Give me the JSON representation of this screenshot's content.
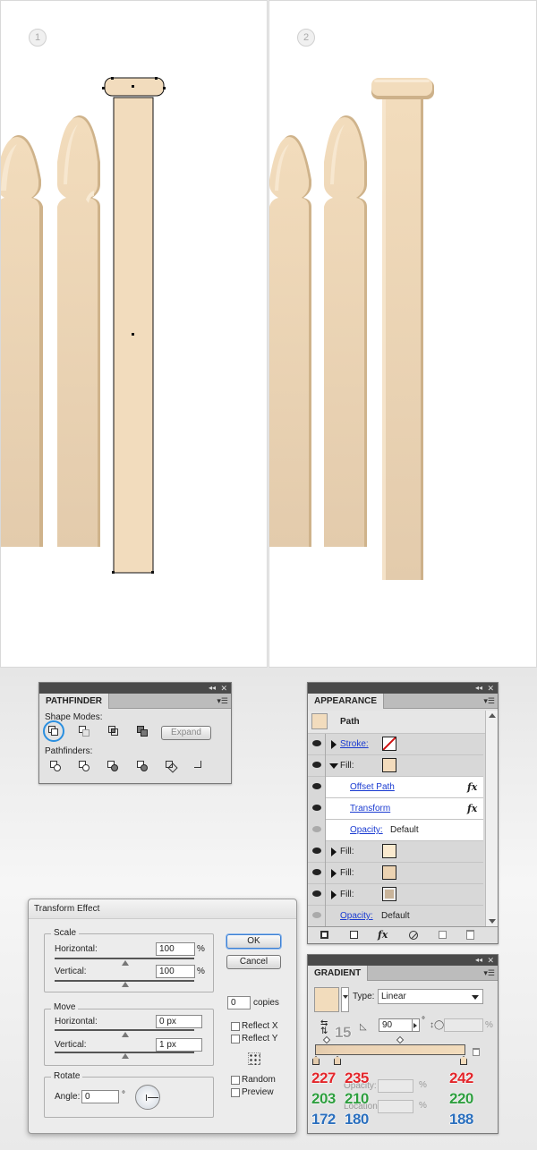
{
  "steps": [
    "1",
    "2"
  ],
  "colors": {
    "picket_light": "#f3dcbd",
    "picket_mid": "#ecd3b2",
    "picket_dark": "#cfb38b",
    "stop1": "#e3cbac",
    "stop2": "#ebd2b4",
    "stop3": "#f2dcbc"
  },
  "pathfinder": {
    "tab": "PATHFINDER",
    "shape_modes_label": "Shape Modes:",
    "expand_label": "Expand",
    "pathfinders_label": "Pathfinders:",
    "shape_mode_icons": [
      "unite-icon",
      "minus-front-icon",
      "intersect-icon",
      "exclude-icon"
    ],
    "pathfinder_icons": [
      "divide-icon",
      "trim-icon",
      "merge-icon",
      "crop-icon",
      "outline-icon",
      "minus-back-icon"
    ]
  },
  "appearance": {
    "tab": "APPEARANCE",
    "object": "Path",
    "rows": [
      {
        "label": "Stroke:",
        "type": "stroke",
        "link": true
      },
      {
        "label": "Fill:",
        "type": "fill-open",
        "swatch": "#f3dcbd"
      },
      {
        "label": "Offset Path",
        "type": "effect",
        "link": true
      },
      {
        "label": "Transform",
        "type": "effect",
        "link": true
      },
      {
        "label": "Opacity:",
        "value": "Default",
        "type": "opacity",
        "link": true
      },
      {
        "label": "Fill:",
        "type": "fill",
        "swatch": "#faeacf"
      },
      {
        "label": "Fill:",
        "type": "fill",
        "swatch": "#ecd3b2"
      },
      {
        "label": "Fill:",
        "type": "fill",
        "swatch": "#c9b49a"
      },
      {
        "label": "Opacity:",
        "value": "Default",
        "type": "opacity",
        "link": true
      }
    ],
    "fx_symbol": "fx"
  },
  "transform_effect": {
    "title": "Transform Effect",
    "scale_label": "Scale",
    "horizontal_label": "Horizontal:",
    "vertical_label": "Vertical:",
    "scale_h": "100",
    "scale_v": "100",
    "percent": "%",
    "move_label": "Move",
    "move_h": "0 px",
    "move_v": "1 px",
    "rotate_label": "Rotate",
    "angle_label": "Angle:",
    "angle": "0",
    "degree": "°",
    "ok": "OK",
    "cancel": "Cancel",
    "copies_value": "0",
    "copies_label": "copies",
    "reflect_x": "Reflect X",
    "reflect_y": "Reflect Y",
    "random": "Random",
    "preview": "Preview"
  },
  "gradient": {
    "tab": "GRADIENT",
    "type_label": "Type:",
    "type_value": "Linear",
    "angle_value": "90",
    "degree": "°",
    "percent": "%",
    "opacity_label": "Opacity:",
    "location_label": "Location:",
    "annotation_angle": "15",
    "rgb_columns": [
      {
        "r": "227",
        "g": "203",
        "b": "172"
      },
      {
        "r": "235",
        "g": "210",
        "b": "180"
      },
      {
        "r": "242",
        "g": "220",
        "b": "188"
      }
    ],
    "annotation_colors": {
      "r": "#e2262b",
      "g": "#2e9e3f",
      "b": "#2b6fbd"
    }
  }
}
